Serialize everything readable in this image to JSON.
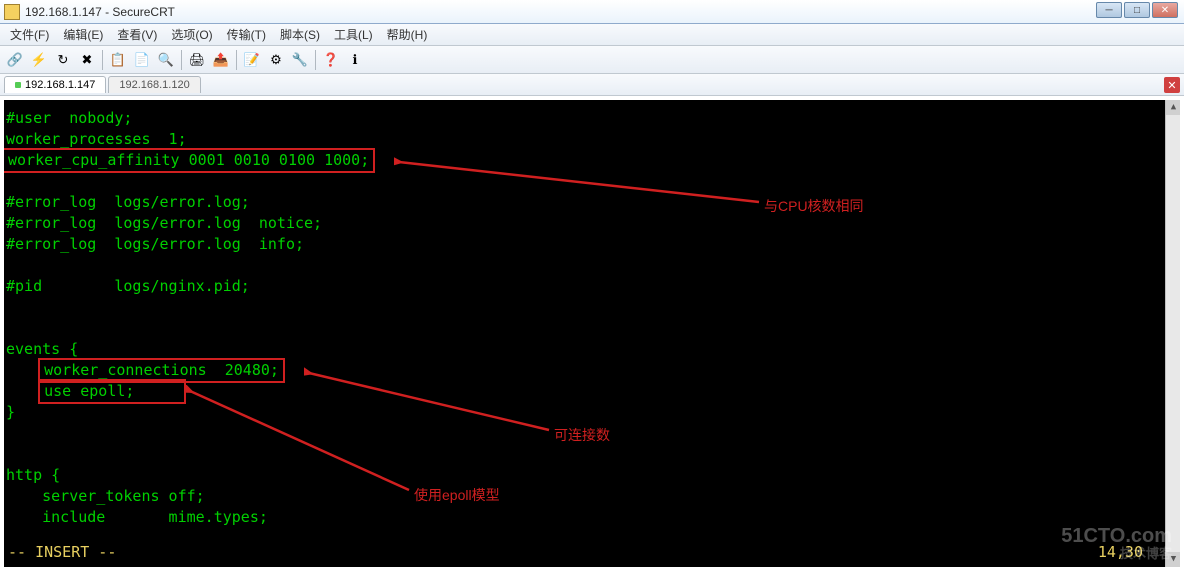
{
  "title": "192.168.1.147 - SecureCRT",
  "menu": [
    "文件(F)",
    "编辑(E)",
    "查看(V)",
    "选项(O)",
    "传输(T)",
    "脚本(S)",
    "工具(L)",
    "帮助(H)"
  ],
  "tabs": [
    {
      "label": "192.168.1.147",
      "active": true
    },
    {
      "label": "192.168.1.120",
      "active": false
    }
  ],
  "config": {
    "l1": "#user  nobody;",
    "l2": "worker_processes  1;",
    "l3": "worker_cpu_affinity 0001 0010 0100 1000;",
    "l4": "#error_log  logs/error.log;",
    "l5": "#error_log  logs/error.log  notice;",
    "l6": "#error_log  logs/error.log  info;",
    "l7": "#pid        logs/nginx.pid;",
    "l8": "events {",
    "l9": "worker_connections  20480;",
    "l10": "use epoll;",
    "l11": "}",
    "l12": "http {",
    "l13": "    server_tokens off;",
    "l14": "    include       mime.types;"
  },
  "annotations": {
    "a1": "与CPU核数相同",
    "a2": "可连接数",
    "a3": "使用epoll模型"
  },
  "status": {
    "mode": "-- INSERT --",
    "pos": "14,30"
  },
  "watermark": {
    "main": "51CTO.com",
    "sub": "技术博客"
  }
}
